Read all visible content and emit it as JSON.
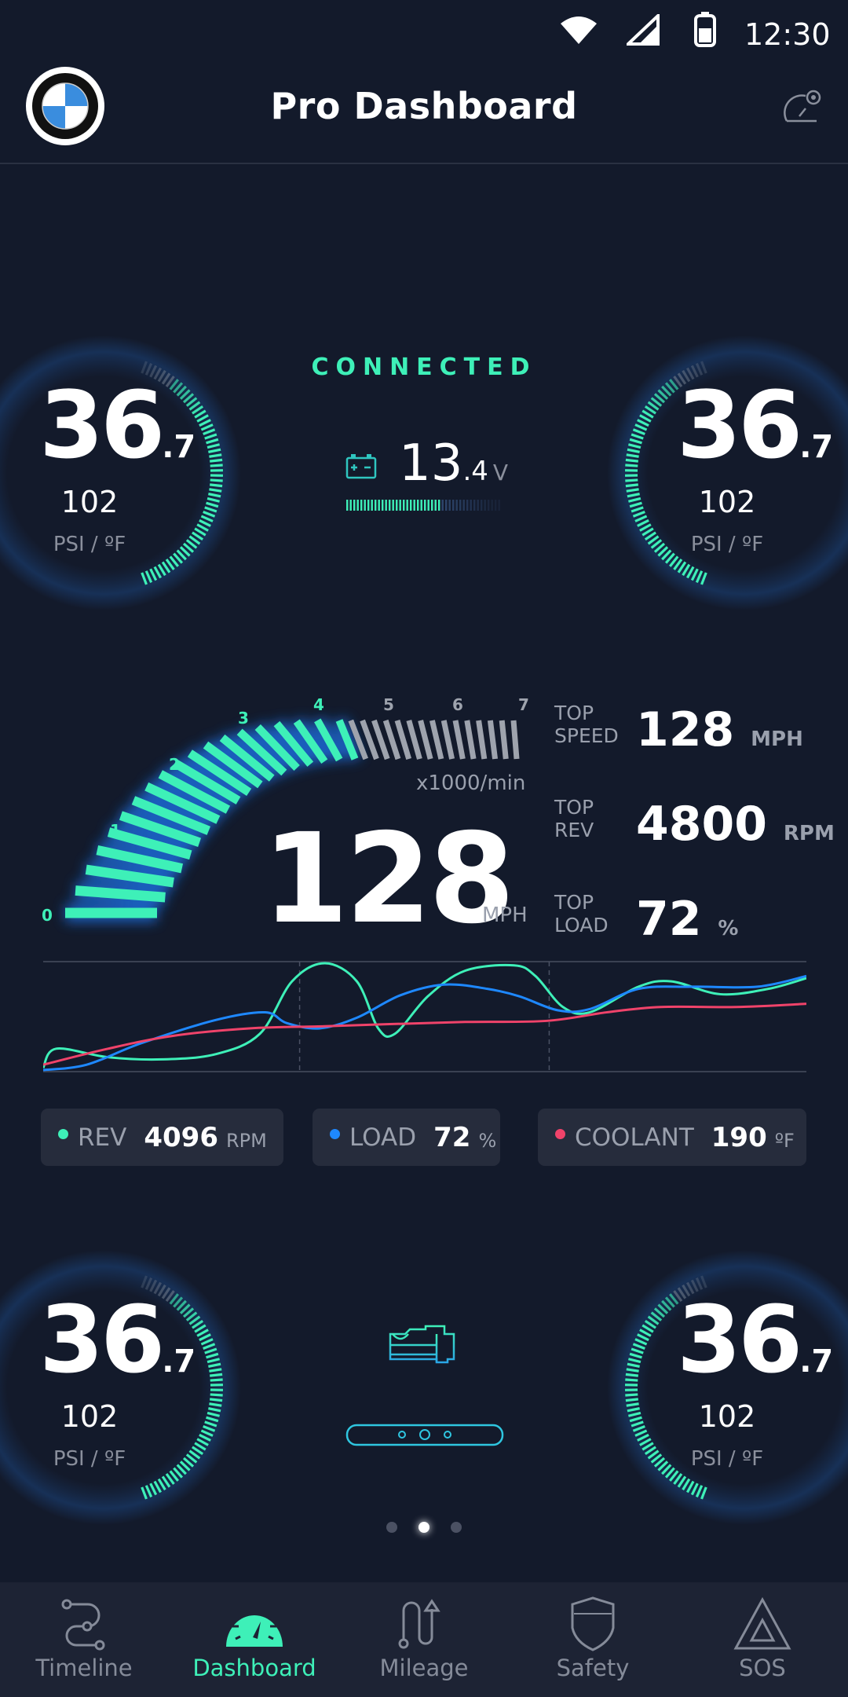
{
  "status_bar": {
    "time": "12:30",
    "icons": [
      "wifi-icon",
      "signal-icon",
      "battery-icon"
    ]
  },
  "header": {
    "title": "Pro Dashboard",
    "logo": "bmw-logo",
    "settings_icon": "gauge-settings-icon"
  },
  "connection": {
    "status": "CONNECTED"
  },
  "battery": {
    "value_int": "13",
    "value_dec": ".4",
    "unit": "V",
    "level": 0.62
  },
  "tire_gauges": [
    {
      "position": "top-left",
      "value_int": "36",
      "value_dec": ".7",
      "temp": "102",
      "unit": "PSI / ºF"
    },
    {
      "position": "top-right",
      "value_int": "36",
      "value_dec": ".7",
      "temp": "102",
      "unit": "PSI / ºF"
    },
    {
      "position": "bottom-left",
      "value_int": "36",
      "value_dec": ".7",
      "temp": "102",
      "unit": "PSI / ºF"
    },
    {
      "position": "bottom-right",
      "value_int": "36",
      "value_dec": ".7",
      "temp": "102",
      "unit": "PSI / ºF"
    }
  ],
  "tachometer": {
    "labels": [
      "0",
      "1",
      "2",
      "3",
      "4",
      "5",
      "6",
      "7"
    ],
    "unit_label": "x1000/min",
    "value": 4
  },
  "speed": {
    "value": "128",
    "unit": "MPH"
  },
  "top_stats": [
    {
      "label1": "TOP",
      "label2": "SPEED",
      "value": "128",
      "unit": "MPH"
    },
    {
      "label1": "TOP",
      "label2": "REV",
      "value": "4800",
      "unit": "RPM"
    },
    {
      "label1": "TOP",
      "label2": "LOAD",
      "value": "72",
      "unit": "%"
    }
  ],
  "chart_data": {
    "type": "line",
    "grid": true,
    "legend": "below",
    "series": [
      {
        "name": "REV",
        "color": "#3ef0b8",
        "x": [
          0,
          1.7,
          8.5,
          15.6,
          22.7,
          28.4,
          32.6,
          36.9,
          41.1,
          43.9,
          46.1,
          50.4,
          55.3,
          61.7,
          64.5,
          68.1,
          71.6,
          78,
          82.3,
          88.7,
          95,
          100
        ],
        "y": [
          2,
          20,
          12,
          10,
          15,
          34,
          83,
          100,
          83,
          39,
          34,
          69,
          93,
          98,
          88,
          59,
          54,
          78,
          83,
          71,
          76,
          86
        ]
      },
      {
        "name": "LOAD",
        "color": "#1e88ff",
        "x": [
          0,
          5.7,
          12.8,
          22.7,
          29.1,
          31.9,
          36.2,
          41.1,
          46.8,
          52.5,
          58.2,
          62.4,
          67.4,
          71.6,
          78,
          85.1,
          93.6,
          100
        ],
        "y": [
          0,
          5,
          25,
          47,
          54,
          44,
          39,
          49,
          70,
          80,
          76,
          69,
          56,
          57,
          76,
          78,
          78,
          88
        ]
      },
      {
        "name": "COOLANT",
        "color": "#f0436a",
        "x": [
          0,
          8.5,
          17,
          27,
          36.9,
          45.4,
          55.3,
          65.9,
          73.8,
          80.9,
          90.8,
          100
        ],
        "y": [
          5,
          20,
          32,
          39,
          41,
          43,
          45,
          46,
          54,
          59,
          59,
          62
        ]
      }
    ]
  },
  "legend": [
    {
      "label": "REV",
      "value": "4096",
      "unit": "RPM",
      "color": "#3ef0b8"
    },
    {
      "label": "LOAD",
      "value": "72",
      "unit": "%",
      "color": "#1e88ff"
    },
    {
      "label": "COOLANT",
      "value": "190",
      "unit": "ºF",
      "color": "#f0436a"
    }
  ],
  "pager": {
    "count": 3,
    "active": 1
  },
  "nav": {
    "items": [
      {
        "label": "Timeline",
        "icon": "timeline-icon"
      },
      {
        "label": "Dashboard",
        "icon": "speedometer-icon"
      },
      {
        "label": "Mileage",
        "icon": "route-icon"
      },
      {
        "label": "Safety",
        "icon": "shield-icon"
      },
      {
        "label": "SOS",
        "icon": "warning-triangle-icon"
      }
    ],
    "active": "Dashboard"
  },
  "colors": {
    "background": "#131a2b",
    "accent": "#3ef0b8",
    "load": "#1e88ff",
    "coolant": "#f0436a"
  }
}
